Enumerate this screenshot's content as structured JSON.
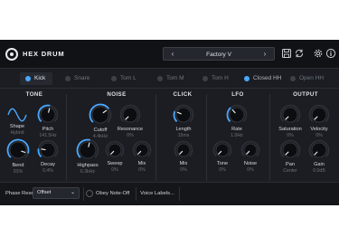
{
  "app": {
    "title": "HEX DRUM"
  },
  "preset": {
    "name": "Factory V",
    "prev": "‹",
    "next": "›"
  },
  "tabs": [
    {
      "label": "Kick"
    },
    {
      "label": "Snare"
    },
    {
      "label": "Tom L"
    },
    {
      "label": "Tom M"
    },
    {
      "label": "Tom H"
    },
    {
      "label": "Closed HH"
    },
    {
      "label": "Open HH"
    }
  ],
  "sections": {
    "tone": "TONE",
    "noise": "NOISE",
    "click": "CLICK",
    "lfo": "LFO",
    "output": "OUTPUT"
  },
  "knobs": {
    "shape": {
      "label": "Shape",
      "value": "Hybrid"
    },
    "pitch": {
      "label": "Pitch",
      "value": "141.5Hz"
    },
    "bend": {
      "label": "Bend",
      "value": "93%"
    },
    "decay": {
      "label": "Decay",
      "value": "0.4%"
    },
    "cutoff": {
      "label": "Cutoff",
      "value": "4.4kHz"
    },
    "resonance": {
      "label": "Resonance",
      "value": "0%"
    },
    "highpass": {
      "label": "Highpass",
      "value": "6.3kHz"
    },
    "sweep": {
      "label": "Sweep",
      "value": "0%"
    },
    "noise_mix": {
      "label": "Mix",
      "value": "0%"
    },
    "length": {
      "label": "Length",
      "value": "15ms"
    },
    "click_mix": {
      "label": "Mix",
      "value": "0%"
    },
    "rate": {
      "label": "Rate",
      "value": "1.0Hz"
    },
    "lfo_tone": {
      "label": "Tone",
      "value": "0%"
    },
    "lfo_noise": {
      "label": "Noise",
      "value": "0%"
    },
    "saturation": {
      "label": "Saturation",
      "value": "0%"
    },
    "velocity": {
      "label": "Velocity",
      "value": "0%"
    },
    "pan": {
      "label": "Pan",
      "value": "Center"
    },
    "gain": {
      "label": "Gain",
      "value": "0.0dB"
    }
  },
  "footer": {
    "phase_reset_label": "Phase Reset",
    "phase_reset_value": "Offset",
    "obey_note_off": "Obey Note-Off",
    "voice_labels": "Voice Labels..."
  },
  "colors": {
    "accent": "#4aa8ff",
    "panel": "#1b1d22",
    "header": "#111215"
  }
}
